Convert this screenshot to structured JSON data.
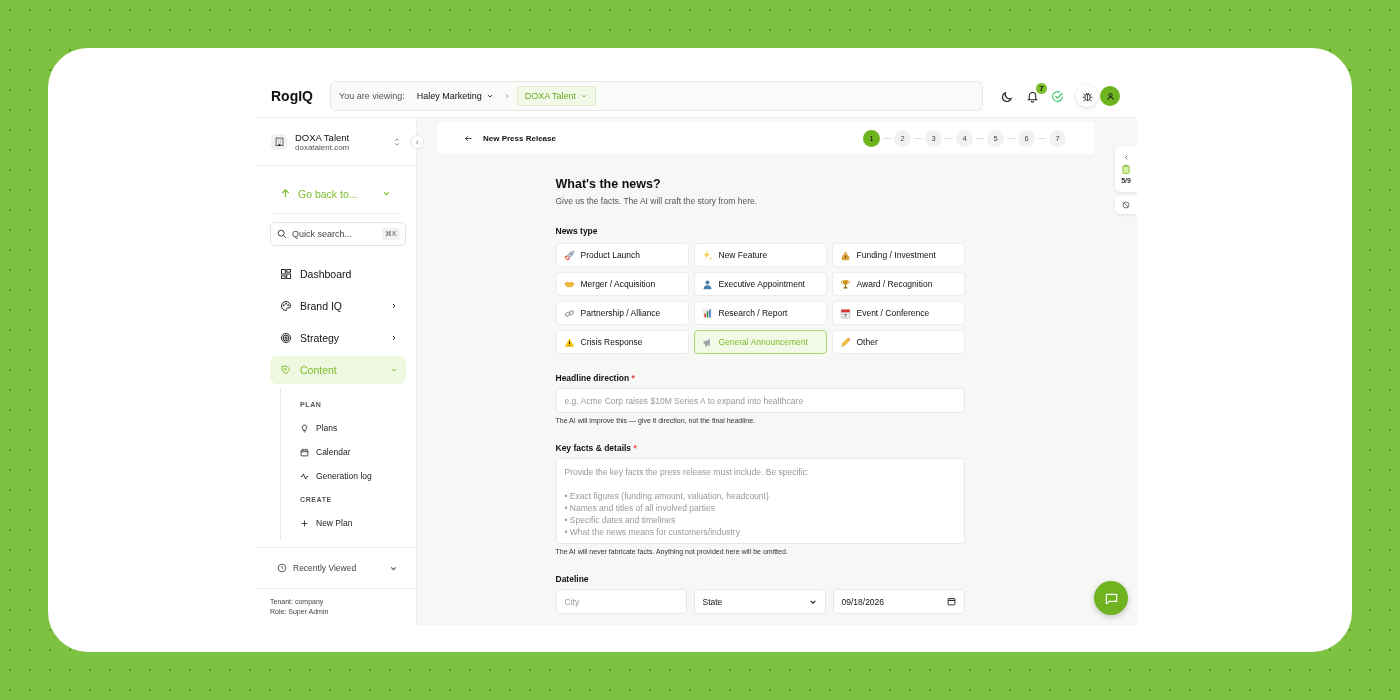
{
  "header": {
    "logo": "RogIQ",
    "context": {
      "label": "You are viewing:",
      "org": "Haley Marketing",
      "separator": "›",
      "client": "DOXA Talent"
    },
    "notifications": "7"
  },
  "sidebar": {
    "tenant": {
      "name": "DOXA Talent",
      "domain": "doxatalent.com"
    },
    "go_back": "Go back to...",
    "search": {
      "placeholder": "Quick search...",
      "shortcut": "⌘K"
    },
    "items": [
      {
        "label": "Dashboard",
        "selected": false
      },
      {
        "label": "Brand IQ",
        "selected": false,
        "expanded": false
      },
      {
        "label": "Strategy",
        "selected": false,
        "expanded": false
      },
      {
        "label": "Content",
        "selected": true,
        "expanded": true,
        "children": [
          {
            "kind": "heading",
            "label": "PLAN"
          },
          {
            "kind": "link",
            "label": "Plans"
          },
          {
            "kind": "link",
            "label": "Calendar"
          },
          {
            "kind": "link",
            "label": "Generation log"
          },
          {
            "kind": "heading",
            "label": "CREATE"
          },
          {
            "kind": "link",
            "label": "New Plan"
          }
        ]
      }
    ],
    "recently_viewed": "Recently Viewed",
    "footer": [
      "Tenant: company",
      "Role: Super Admin"
    ]
  },
  "topbar": {
    "title": "New Press Release",
    "steps": [
      {
        "label": "1",
        "selected": true
      },
      {
        "label": "2",
        "selected": false
      },
      {
        "label": "3",
        "selected": false
      },
      {
        "label": "4",
        "selected": false
      },
      {
        "label": "5",
        "selected": false
      },
      {
        "label": "6",
        "selected": false
      },
      {
        "label": "7",
        "selected": false
      }
    ]
  },
  "side_panel": {
    "counter": "5/9"
  },
  "form": {
    "title": "What's the news?",
    "subtitle": "Give us the facts. The AI will craft the story from here.",
    "news_type_label": "News type",
    "news_types": [
      {
        "label": "Product Launch",
        "selected": false
      },
      {
        "label": "New Feature",
        "selected": false
      },
      {
        "label": "Funding / Investment",
        "selected": false
      },
      {
        "label": "Merger / Acquisition",
        "selected": false
      },
      {
        "label": "Executive Appointment",
        "selected": false
      },
      {
        "label": "Award / Recognition",
        "selected": false
      },
      {
        "label": "Partnership / Alliance",
        "selected": false
      },
      {
        "label": "Research / Report",
        "selected": false
      },
      {
        "label": "Event / Conference",
        "selected": false
      },
      {
        "label": "Crisis Response",
        "selected": false
      },
      {
        "label": "General Announcement",
        "selected": true
      },
      {
        "label": "Other",
        "selected": false
      }
    ],
    "headline": {
      "label": "Headline direction",
      "required": "*",
      "placeholder": "e.g. Acme Corp raises $10M Series A to expand into healthcare",
      "hint": "The AI will improve this — give it direction, not the final headline."
    },
    "facts": {
      "label": "Key facts & details",
      "required": "*",
      "placeholder": "Provide the key facts the press release must include. Be specific:\n\n• Exact figures (funding amount, valuation, headcount)\n• Names and titles of all involved parties\n• Specific dates and timelines\n• What the news means for customers/industry",
      "hint": "The AI will never fabricate facts. Anything not provided here will be omitted."
    },
    "dateline": {
      "label": "Dateline",
      "city_placeholder": "City",
      "state": "State",
      "date": "09/18/2026"
    }
  }
}
